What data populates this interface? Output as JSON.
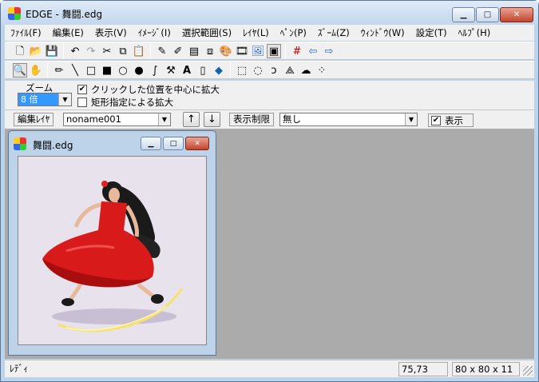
{
  "window": {
    "title": "EDGE - 舞闘.edg"
  },
  "menu": [
    "ﾌｧｲﾙ(F)",
    "編集(E)",
    "表示(V)",
    "ｲﾒｰｼﾞ(I)",
    "選択範囲(S)",
    "ﾚｲﾔ(L)",
    "ﾍﾟﾝ(P)",
    "ｽﾞｰﾑ(Z)",
    "ｳｨﾝﾄﾞｳ(W)",
    "設定(T)",
    "ﾍﾙﾌﾟ(H)"
  ],
  "zoom": {
    "label": "ズーム",
    "value": "8 倍",
    "center_option": "クリックした位置を中心に拡大",
    "center_checked": true,
    "rect_option": "矩形指定による拡大",
    "rect_checked": false
  },
  "layer": {
    "label": "編集ﾚｲﾔ",
    "value": "noname001",
    "up": "↑",
    "down": "↓",
    "limit_label": "表示制限",
    "limit_value": "無し",
    "show_label": "表示",
    "show_checked": true
  },
  "document": {
    "title": "舞闘.edg"
  },
  "status": {
    "text": "ﾚﾃﾞｨ",
    "coords": "75,73",
    "size": "80 x 80 x 11"
  },
  "colors": {
    "accent": "#3399ff",
    "workspace": "#ababab",
    "canvas_bg": "#e7e2ec",
    "dress": "#d91a1a"
  }
}
